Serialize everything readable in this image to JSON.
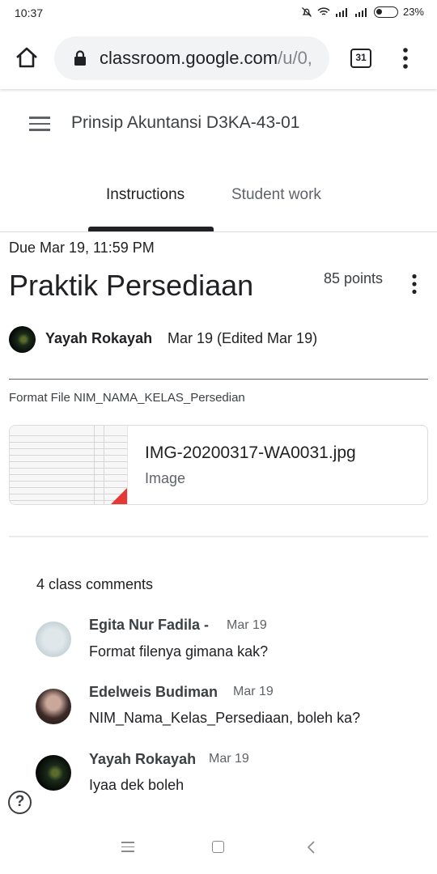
{
  "status_bar": {
    "time": "10:37",
    "battery": "23%"
  },
  "browser": {
    "url_main": "classroom.google.com",
    "url_rest": "/u/0,",
    "tabs_count": "31"
  },
  "header": {
    "class_title": "Prinsip Akuntansi D3KA-43-01"
  },
  "tabs": {
    "instructions": "Instructions",
    "student_work": "Student work"
  },
  "assignment": {
    "due": "Due Mar 19, 11:59 PM",
    "title": "Praktik Persediaan",
    "points": "85 points",
    "author": "Yayah Rokayah",
    "date": "Mar 19 (Edited Mar 19)",
    "description": "Format File NIM_NAMA_KELAS_Persedian"
  },
  "attachment": {
    "name": "IMG-20200317-WA0031.jpg",
    "type": "Image"
  },
  "comments": {
    "count_label": "4 class comments",
    "items": [
      {
        "author": "Egita Nur Fadila -",
        "date": "Mar 19",
        "text": "Format filenya gimana kak?"
      },
      {
        "author": "Edelweis Budiman",
        "date": "Mar 19",
        "text": "NIM_Nama_Kelas_Persediaan, boleh ka?"
      },
      {
        "author": "Yayah Rokayah",
        "date": "Mar 19",
        "text": "Iyaa dek boleh"
      }
    ]
  },
  "help": {
    "label": "?"
  },
  "icons": {
    "home": "home-icon",
    "lock": "lock-icon",
    "tabs": "tabs-icon",
    "more": "more-vert-icon",
    "menu": "hamburger-menu-icon",
    "help": "help-icon"
  },
  "colors": {
    "text": "#202124",
    "secondary": "#5f6368",
    "tab_indicator": "#202124",
    "divider": "#dadce0"
  }
}
